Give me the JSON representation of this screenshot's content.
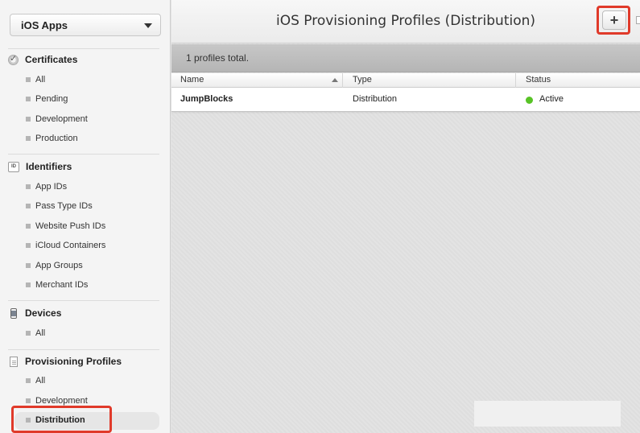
{
  "sidebar": {
    "app_select": "iOS Apps",
    "sections": {
      "certificates": {
        "title": "Certificates",
        "items": [
          "All",
          "Pending",
          "Development",
          "Production"
        ]
      },
      "identifiers": {
        "title": "Identifiers",
        "icon_text": "ID",
        "items": [
          "App IDs",
          "Pass Type IDs",
          "Website Push IDs",
          "iCloud Containers",
          "App Groups",
          "Merchant IDs"
        ]
      },
      "devices": {
        "title": "Devices",
        "items": [
          "All"
        ]
      },
      "provisioning": {
        "title": "Provisioning Profiles",
        "items": [
          "All",
          "Development",
          "Distribution"
        ],
        "selected": "Distribution"
      }
    }
  },
  "header": {
    "title": "iOS Provisioning Profiles (Distribution)",
    "add_label": "+"
  },
  "summary": "1 profiles total.",
  "table": {
    "columns": [
      "Name",
      "Type",
      "Status"
    ],
    "rows": [
      {
        "name": "JumpBlocks",
        "type": "Distribution",
        "status": "Active"
      }
    ]
  },
  "colors": {
    "annotation": "#e03a2a",
    "status_active": "#58c326"
  }
}
